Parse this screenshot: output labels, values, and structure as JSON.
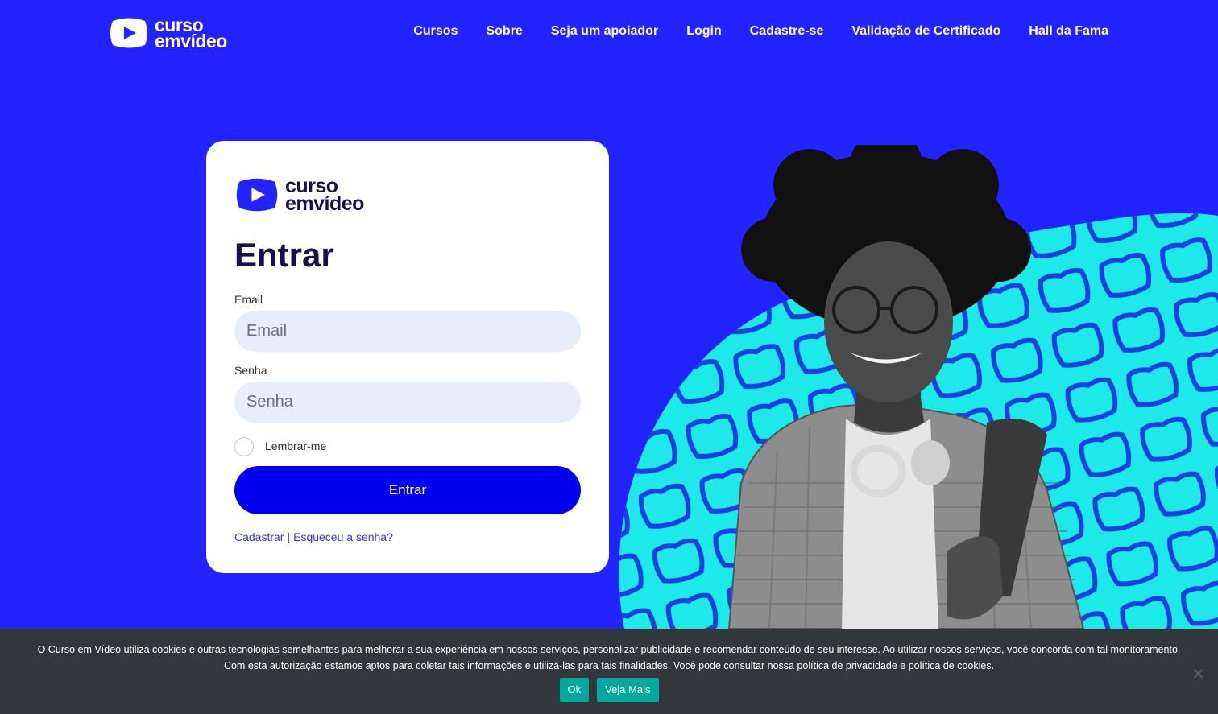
{
  "header": {
    "logo": {
      "line1": "curso",
      "line2": "emvídeo"
    },
    "nav": [
      "Cursos",
      "Sobre",
      "Seja um apoiador",
      "Login",
      "Cadastre-se",
      "Validação de Certificado",
      "Hall da Fama"
    ]
  },
  "login": {
    "logo": {
      "line1": "curso",
      "line2": "emvídeo"
    },
    "title": "Entrar",
    "email_label": "Email",
    "email_placeholder": "Email",
    "password_label": "Senha",
    "password_placeholder": "Senha",
    "remember_label": "Lembrar-me",
    "submit_label": "Entrar",
    "register_link": "Cadastrar",
    "separator": "|",
    "forgot_link": "Esqueceu a senha?"
  },
  "hero": {
    "image": "smiling-student-with-headphones-photo"
  },
  "cookie": {
    "text": "O Curso em Vídeo utiliza cookies e outras tecnologias semelhantes para melhorar a sua experiência em nossos serviços, personalizar publicidade e recomendar conteúdo de seu interesse. Ao utilizar nossos serviços, você concorda com tal monitoramento. Com esta autorização estamos aptos para coletar tais informações e utilizá-las para tais finalidades. Você pode consultar nossa política de privacidade e política de cookies.",
    "ok_label": "Ok",
    "more_label": "Veja Mais",
    "close_icon": "close-icon"
  },
  "colors": {
    "background": "#2323ff",
    "primary_button": "#0000ee",
    "accent_cyan": "#1de9e9",
    "cookie_bar": "#32373c",
    "cookie_button": "#00a99d",
    "logo_dark": "#1a0f4a"
  }
}
